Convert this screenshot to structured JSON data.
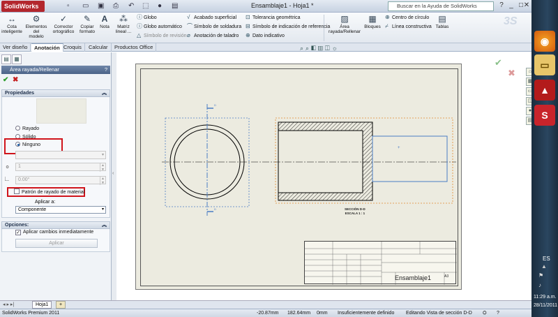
{
  "app": {
    "logo": "SolidWorks",
    "doc_title": "Ensamblaje1 - Hoja1 *",
    "help_search_placeholder": "Buscar en la Ayuda de SolidWorks",
    "window_buttons": [
      "_",
      "□",
      "✕"
    ]
  },
  "ribbon": {
    "big_buttons": [
      {
        "label": "Cota\ninteligente",
        "icon": "smart-dimension-icon"
      },
      {
        "label": "Elementos\ndel\nmodelo",
        "icon": "model-items-icon"
      },
      {
        "label": "Corrector\nortográfico",
        "icon": "spell-checker-icon"
      },
      {
        "label": "Copiar\nformato",
        "icon": "format-painter-icon"
      },
      {
        "label": "Nota",
        "icon": "note-icon"
      },
      {
        "label": "Matriz\nlineal ...",
        "icon": "linear-pattern-icon"
      }
    ],
    "col1": [
      "Globo",
      "Globo automático",
      "Símbolo de revisión"
    ],
    "col2": [
      "Acabado superficial",
      "Símbolo de soldadura",
      "Anotación de taladro"
    ],
    "col3": [
      "Tolerancia geométrica",
      "Símbolo de indicación de referencia",
      "Dato indicativo"
    ],
    "area_button": "Área\nrayada/Rellenar",
    "blocks_button": "Bloques",
    "col4": [
      "Centro de círculo",
      "Línea constructiva"
    ],
    "tables_button": "Tablas"
  },
  "tabs": [
    "Ver diseño",
    "Anotación",
    "Croquis",
    "Calcular",
    "Productos Office"
  ],
  "active_tab": "Anotación",
  "property_manager": {
    "title": "Área rayada/Rellenar",
    "help": "?",
    "properties_header": "Propiedades",
    "radio_rayado": "Rayado",
    "radio_solido": "Sólido",
    "radio_ninguno": "Ninguno",
    "scale_value": "1",
    "angle_value": "0.00°",
    "material_checkbox": "Patrón de rayado de material",
    "apply_to_label": "Aplicar a:",
    "apply_to_value": "Componente",
    "options_header": "Opciones:",
    "apply_immediately": "Aplicar cambios inmediatamente",
    "apply_button": "Aplicar"
  },
  "drawing": {
    "section_label_1": "SECCIÓN D-D",
    "section_label_2": "ESCALA 1 : 1",
    "section_letter": "D",
    "titleblock_name": "Ensamblaje1",
    "titleblock_size": "A3"
  },
  "sheet_tab": "Hoja1",
  "status": {
    "product": "SolidWorks Premium 2011",
    "x": "-20.87mm",
    "y": "182.64mm",
    "z": "0mm",
    "definition": "Insuficientemente definido",
    "editing": "Editando Vista de sección D-D",
    "help": "?"
  },
  "taskbar": {
    "apps": [
      "firefox",
      "files",
      "acrobat",
      "solidworks"
    ],
    "language": "ES",
    "time": "11:29 a.m.",
    "date": "28/11/2011"
  },
  "colors": {
    "accent": "#4c6488",
    "highlight": "#d0141b",
    "sheet": "#ecebe0",
    "hatch_bounds": "#e08a2e",
    "section_line": "#4a7cc4"
  }
}
